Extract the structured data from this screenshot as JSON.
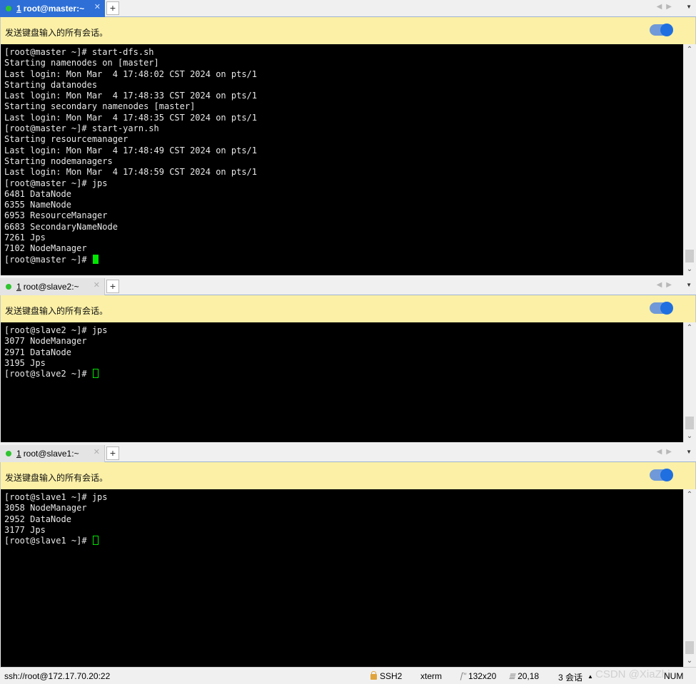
{
  "sendbar_label": "发送键盘输入的所有会话。",
  "panes": [
    {
      "tab_num": "1",
      "tab_title": "root@master:~",
      "lines": [
        "[root@master ~]# start-dfs.sh",
        "Starting namenodes on [master]",
        "Last login: Mon Mar  4 17:48:02 CST 2024 on pts/1",
        "Starting datanodes",
        "Last login: Mon Mar  4 17:48:33 CST 2024 on pts/1",
        "Starting secondary namenodes [master]",
        "Last login: Mon Mar  4 17:48:35 CST 2024 on pts/1",
        "[root@master ~]# start-yarn.sh",
        "Starting resourcemanager",
        "Last login: Mon Mar  4 17:48:49 CST 2024 on pts/1",
        "Starting nodemanagers",
        "Last login: Mon Mar  4 17:48:59 CST 2024 on pts/1",
        "[root@master ~]# jps",
        "6481 DataNode",
        "6355 NameNode",
        "6953 ResourceManager",
        "6683 SecondaryNameNode",
        "7261 Jps",
        "7102 NodeManager"
      ],
      "prompt": "[root@master ~]# "
    },
    {
      "tab_num": "1",
      "tab_title": "root@slave2:~",
      "lines": [
        "[root@slave2 ~]# jps",
        "3077 NodeManager",
        "2971 DataNode",
        "3195 Jps"
      ],
      "prompt": "[root@slave2 ~]# "
    },
    {
      "tab_num": "1",
      "tab_title": "root@slave1:~",
      "lines": [
        "[root@slave1 ~]# jps",
        "3058 NodeManager",
        "2952 DataNode",
        "3177 Jps"
      ],
      "prompt": "[root@slave1 ~]# "
    }
  ],
  "statusbar": {
    "connection": "ssh://root@172.17.70.20:22",
    "protocol": "SSH2",
    "terminal": "xterm",
    "size": "132x20",
    "cursor_pos": "20,18",
    "sessions": "3 会话",
    "watermark": "CSDN @XiaZhi",
    "caps": "NUM"
  }
}
